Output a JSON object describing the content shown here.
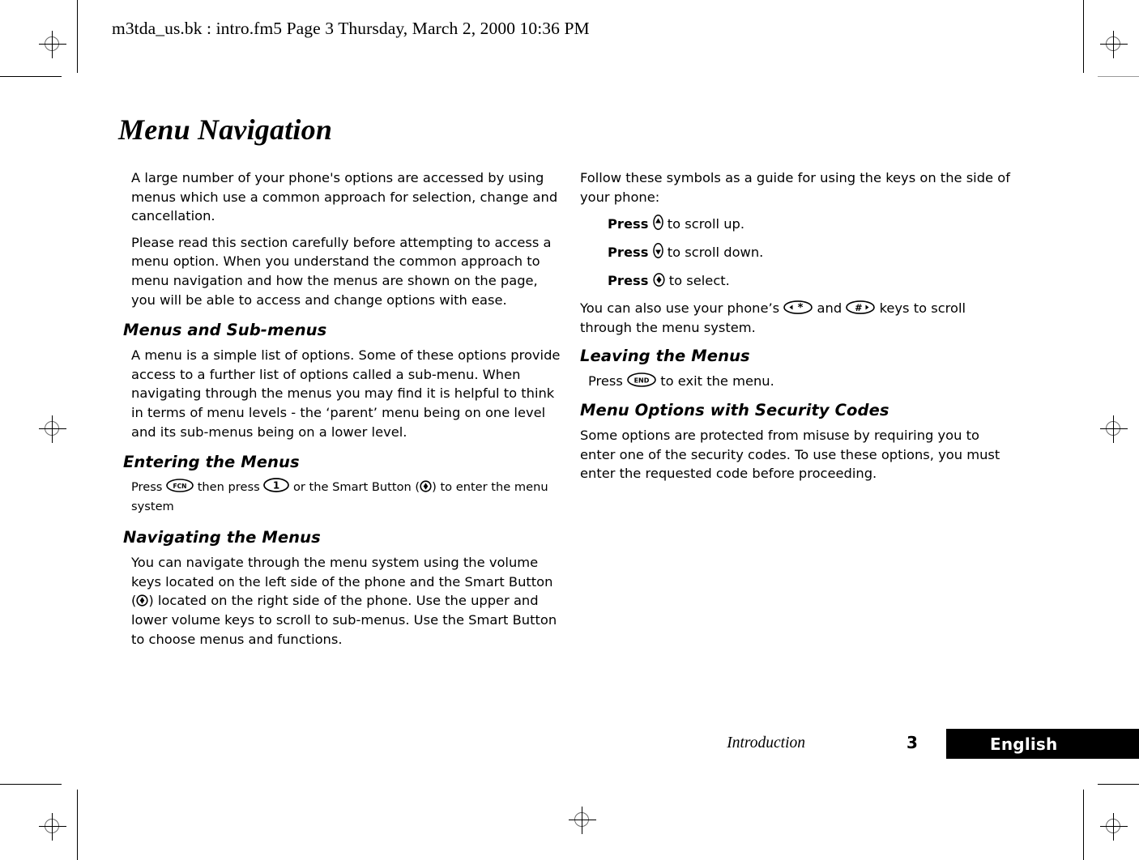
{
  "header": {
    "text": "m3tda_us.bk : intro.fm5  Page 3  Thursday, March 2, 2000  10:36 PM"
  },
  "page": {
    "title": "Menu Navigation"
  },
  "left_column": {
    "intro_paragraphs": [
      "A large number of your phone's options are accessed by using menus which use a common approach for selection, change and cancellation.",
      "Please read this section carefully before attempting to access a menu option. When you understand the common approach to menu navigation and how the menus are shown on the page, you will be able to access and change options with ease."
    ],
    "sections": [
      {
        "heading": "Menus and Sub-menus",
        "paragraph": "A menu is a simple list of options. Some of these options provide access to a further list of options called a sub-menu. When navigating through the menus you may find it is helpful to think in terms of menu levels - the ‘parent’ menu being on one level and its sub-menus being on a lower level."
      },
      {
        "heading": "Entering the Menus",
        "press_word": "Press",
        "then_press_word": "then press",
        "or_smart_button": "or the Smart Button (",
        "tail": ") to enter the menu system",
        "fcn_key_label": "FCN",
        "one_key_label": "1"
      },
      {
        "heading": "Navigating the Menus",
        "part1": "You can navigate through the menu system using the volume keys located on the left side of the phone and the Smart Button (",
        "part2": ") located on the right side of the phone. Use the upper and lower volume keys to scroll to sub-menus. Use the Smart Button to choose menus and functions."
      }
    ]
  },
  "right_column": {
    "intro_paragraph": "Follow these symbols as a guide for using the keys on the side of your phone:",
    "press_items": [
      {
        "press": "Press",
        "action": "to scroll up.",
        "icon": "volume-up-key-icon"
      },
      {
        "press": "Press",
        "action": "to scroll down.",
        "icon": "volume-down-key-icon"
      },
      {
        "press": "Press",
        "action": "to select.",
        "icon": "smart-button-key-icon"
      }
    ],
    "also_use": {
      "part1": "You can also use your phone’s",
      "and_word": "and",
      "part2": "keys to scroll through the menu system.",
      "star_key_label": "∗",
      "pound_key_label": "#"
    },
    "sections": [
      {
        "heading": "Leaving the Menus",
        "press_word": "Press",
        "end_key_label": "END",
        "tail": "to exit the menu."
      },
      {
        "heading": "Menu Options with Security Codes",
        "paragraph": "Some options are protected from misuse by requiring you to enter one of the security codes. To use these options, you must enter the requested code before proceeding."
      }
    ]
  },
  "footer": {
    "chapter": "Introduction",
    "page_number": "3",
    "language": "English",
    "bar_color": "#000000",
    "language_text_color": "#ffffff"
  }
}
